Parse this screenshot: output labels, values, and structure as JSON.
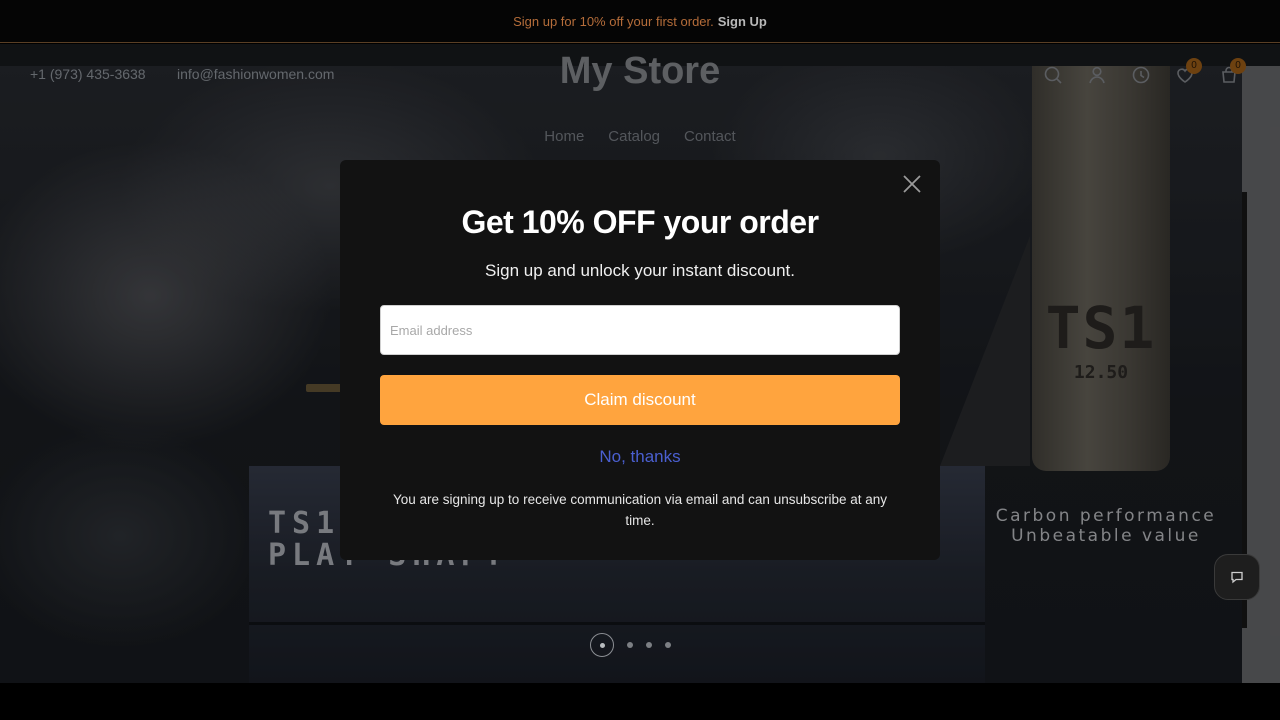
{
  "announcement": {
    "text": "Sign up for 10% off your first order.",
    "link": "Sign Up"
  },
  "header": {
    "phone": "+1 (973) 435-3638",
    "email": "info@fashionwomen.com",
    "logo": "My Store",
    "nav": [
      "Home",
      "Catalog",
      "Contact"
    ],
    "icons": [
      "search-icon",
      "account-icon",
      "recently-viewed-icon",
      "wishlist-icon",
      "cart-icon"
    ],
    "wishlist_count": "0",
    "cart_count": "0"
  },
  "hero": {
    "box_text_line1": "TS1",
    "box_text_line2": "PLAY SHAFT",
    "product_mark": "TS1",
    "product_number": "12.50",
    "tagline_line1": "Carbon performance",
    "tagline_line2": "Unbeatable value",
    "slides_total": 4,
    "slide_active": 1
  },
  "modal": {
    "title": "Get 10% OFF your order",
    "subtitle": "Sign up and unlock your instant discount.",
    "email_placeholder": "Email address",
    "email_value": "",
    "claim_label": "Claim discount",
    "decline_label": "No, thanks",
    "legal": "You are signing up to receive communication via email and can unsubscribe at any time."
  },
  "colors": {
    "accent": "#ffa43e",
    "decline_link": "#4a5fd0",
    "modal_bg": "#121212"
  }
}
